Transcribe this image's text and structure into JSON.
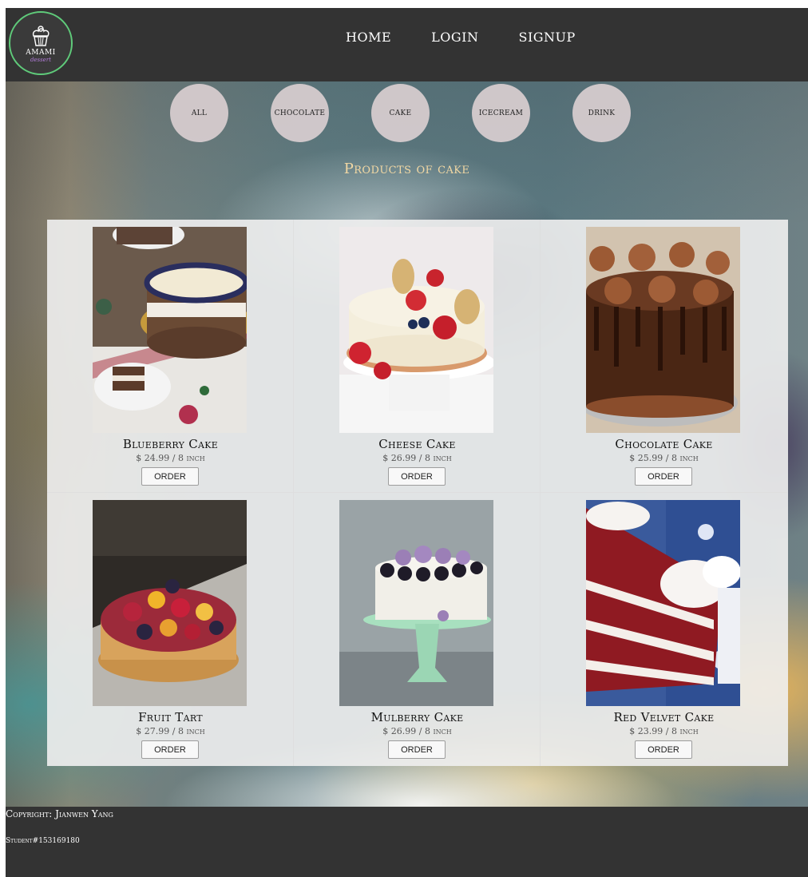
{
  "logo": {
    "brand": "AMAMI",
    "sub": "dessert"
  },
  "nav": {
    "home": "HOME",
    "login": "LOGIN",
    "signup": "SIGNUP"
  },
  "categories": [
    "All",
    "Chocolate",
    "Cake",
    "Icecream",
    "Drink"
  ],
  "section_title": "Products of cake",
  "products": [
    {
      "name": "Blueberry Cake",
      "price": "$ 24.99 / 8 inch",
      "button": "ORDER"
    },
    {
      "name": "Cheese Cake",
      "price": "$ 26.99 / 8 inch",
      "button": "ORDER"
    },
    {
      "name": "Chocolate Cake",
      "price": "$ 25.99 / 8 inch",
      "button": "ORDER"
    },
    {
      "name": "Fruit Tart",
      "price": "$ 27.99 / 8 inch",
      "button": "ORDER"
    },
    {
      "name": "Mulberry Cake",
      "price": "$ 26.99 / 8 inch",
      "button": "ORDER"
    },
    {
      "name": "Red Velvet Cake",
      "price": "$ 23.99 / 8 inch",
      "button": "ORDER"
    }
  ],
  "footer": {
    "copyright": "Copyright: Jianwen Yang",
    "student": "Student#153169180"
  },
  "colors": {
    "bar": "#333333",
    "logo_ring": "#5fcb7a",
    "logo_sub": "#b07bd6",
    "title": "#f2d8a4"
  }
}
